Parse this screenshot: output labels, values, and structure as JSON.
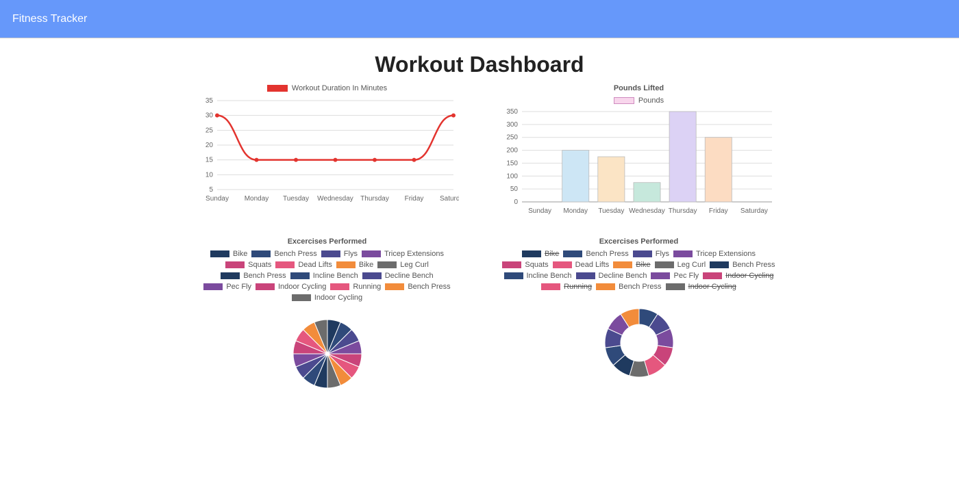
{
  "header": {
    "title": "Fitness Tracker"
  },
  "page": {
    "title": "Workout Dashboard"
  },
  "line_chart": {
    "legend_label": "Workout Duration In Minutes",
    "legend_color": "#e3342f"
  },
  "bar_chart": {
    "title": "Pounds Lifted",
    "legend_label": "Pounds"
  },
  "pie_chart": {
    "title": "Excercises Performed"
  },
  "doughnut_chart": {
    "title": "Excercises Performed"
  },
  "exercise_colors": {
    "Bike": "#1f3a5f",
    "Bench Press": "#2f4a7a",
    "Flys": "#4b4a8f",
    "Tricep Extensions": "#7b4b9e",
    "Squats": "#c9447a",
    "Dead Lifts": "#e5577e",
    "Bike2": "#f28c3b",
    "Leg Curl": "#6c6c6c",
    "Bench Press2": "#1f3a5f",
    "Incline Bench": "#2f4a7a",
    "Decline Bench": "#4b4a8f",
    "Pec Fly": "#7b4b9e",
    "Indoor Cycling": "#c9447a",
    "Running": "#e5577e",
    "Bench Press3": "#f28c3b",
    "Indoor Cycling2": "#6c6c6c"
  },
  "doughnut_struck": [
    "Bike",
    "Bike2",
    "Indoor Cycling",
    "Running",
    "Indoor Cycling2"
  ],
  "chart_data": [
    {
      "type": "line",
      "title": "",
      "legend": "Workout Duration In Minutes",
      "xlabel": "",
      "ylabel": "",
      "categories": [
        "Sunday",
        "Monday",
        "Tuesday",
        "Wednesday",
        "Thursday",
        "Friday",
        "Saturday"
      ],
      "values": [
        30,
        15,
        15,
        15,
        15,
        15,
        30
      ],
      "ylim": [
        5,
        35
      ],
      "yticks": [
        5,
        10,
        15,
        20,
        25,
        30,
        35
      ]
    },
    {
      "type": "bar",
      "title": "Pounds Lifted",
      "legend": "Pounds",
      "xlabel": "",
      "ylabel": "",
      "categories": [
        "Sunday",
        "Monday",
        "Tuesday",
        "Wednesday",
        "Thursday",
        "Friday",
        "Saturday"
      ],
      "values": [
        0,
        200,
        175,
        75,
        350,
        250,
        0
      ],
      "ylim": [
        0,
        350
      ],
      "yticks": [
        0,
        50,
        100,
        150,
        200,
        250,
        300,
        350
      ],
      "colors": [
        "#cde6f5",
        "#cde6f5",
        "#fbe4c5",
        "#c6e8dc",
        "#dcd2f5",
        "#fcdcc2",
        "#cde6f5"
      ]
    },
    {
      "type": "pie",
      "title": "Excercises Performed",
      "series": [
        {
          "name": "Bike",
          "value": 1
        },
        {
          "name": "Bench Press",
          "value": 1
        },
        {
          "name": "Flys",
          "value": 1
        },
        {
          "name": "Tricep Extensions",
          "value": 1
        },
        {
          "name": "Squats",
          "value": 1
        },
        {
          "name": "Dead Lifts",
          "value": 1
        },
        {
          "name": "Bike",
          "value": 1
        },
        {
          "name": "Leg Curl",
          "value": 1
        },
        {
          "name": "Bench Press",
          "value": 1
        },
        {
          "name": "Incline Bench",
          "value": 1
        },
        {
          "name": "Decline Bench",
          "value": 1
        },
        {
          "name": "Pec Fly",
          "value": 1
        },
        {
          "name": "Indoor Cycling",
          "value": 1
        },
        {
          "name": "Running",
          "value": 1
        },
        {
          "name": "Bench Press",
          "value": 1
        },
        {
          "name": "Indoor Cycling",
          "value": 1
        }
      ]
    },
    {
      "type": "doughnut",
      "title": "Excercises Performed",
      "series": [
        {
          "name": "Bike",
          "value": 1,
          "hidden": true
        },
        {
          "name": "Bench Press",
          "value": 1
        },
        {
          "name": "Flys",
          "value": 1
        },
        {
          "name": "Tricep Extensions",
          "value": 1
        },
        {
          "name": "Squats",
          "value": 1
        },
        {
          "name": "Dead Lifts",
          "value": 1
        },
        {
          "name": "Bike",
          "value": 1,
          "hidden": true
        },
        {
          "name": "Leg Curl",
          "value": 1
        },
        {
          "name": "Bench Press",
          "value": 1
        },
        {
          "name": "Incline Bench",
          "value": 1
        },
        {
          "name": "Decline Bench",
          "value": 1
        },
        {
          "name": "Pec Fly",
          "value": 1
        },
        {
          "name": "Indoor Cycling",
          "value": 1,
          "hidden": true
        },
        {
          "name": "Running",
          "value": 1,
          "hidden": true
        },
        {
          "name": "Bench Press",
          "value": 1
        },
        {
          "name": "Indoor Cycling",
          "value": 1,
          "hidden": true
        }
      ]
    }
  ]
}
